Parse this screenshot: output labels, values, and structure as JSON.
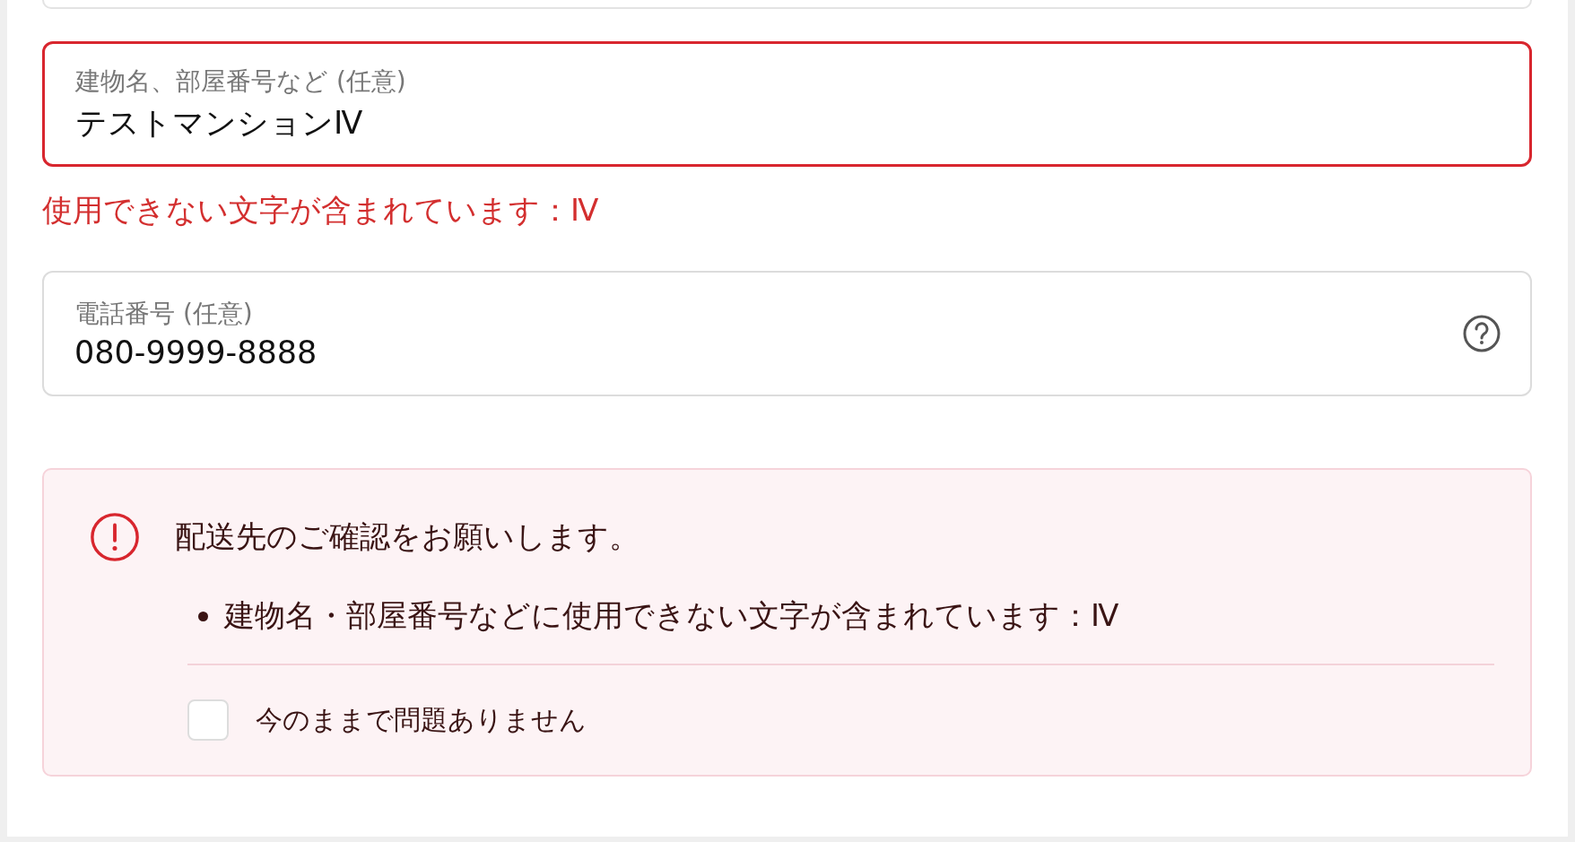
{
  "fields": [
    {
      "label": "建物名、部屋番号など (任意)",
      "value": "テストマンションⅣ",
      "error": true,
      "error_message": "使用できない文字が含まれています：Ⅳ",
      "help": false
    },
    {
      "label": "電話番号 (任意)",
      "value": "080-9999-8888",
      "error": false,
      "help": true
    }
  ],
  "alert": {
    "title": "配送先のご確認をお願いします。",
    "items": [
      "建物名・部屋番号などに使用できない文字が含まれています：Ⅳ"
    ],
    "confirm": {
      "label": "今のままで問題ありません",
      "checked": false
    }
  }
}
